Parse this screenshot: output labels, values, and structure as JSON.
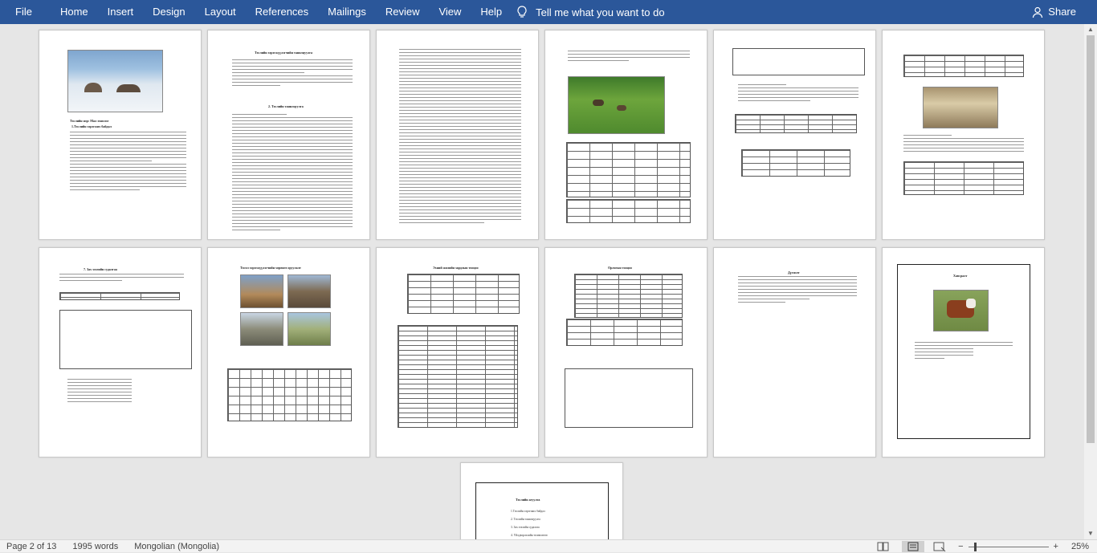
{
  "ribbon": {
    "file": "File",
    "tabs": [
      "Home",
      "Insert",
      "Design",
      "Layout",
      "References",
      "Mailings",
      "Review",
      "View",
      "Help"
    ],
    "tell_me": "Tell me what you want to do",
    "share": "Share"
  },
  "pages": {
    "p1": {
      "title": "Төслийн нэр: Мал эмнэлэг",
      "section": "1.Төслийн хэрэгжих байдал"
    },
    "p2": {
      "title": "Төслийн хэрэгжүүлэгчийн танилцуулга",
      "section": "2. Төслийн танилцуулга"
    },
    "p8": {
      "title": "7. Зах зээлийн судалгаа"
    },
    "p9": {
      "title": "Төсөл хэрэгжүүлэгчийн хөрөнгө оруулалт"
    },
    "p10": {
      "title": "Эхний жилийн зардлын тооцоо"
    },
    "p11": {
      "title": "Орлогын тооцоо"
    },
    "p12": {
      "title": "Дүгнэлт"
    },
    "p13": {
      "caption": "Хавсралт"
    },
    "p14": {
      "title": "Төслийн агуулга",
      "toc": [
        "1.Төслийн хэрэгжих байдал",
        "2. Төслийн танилцуулга",
        "3. Зах зээлийн судалгаа",
        "4. Үйлдвэрлэлийн төлөвлөгөө"
      ]
    }
  },
  "status": {
    "page": "Page 2 of 13",
    "words": "1995 words",
    "language": "Mongolian (Mongolia)",
    "zoom": "25%"
  },
  "colors": {
    "ribbon": "#2b579a",
    "canvas": "#e6e6e6"
  }
}
